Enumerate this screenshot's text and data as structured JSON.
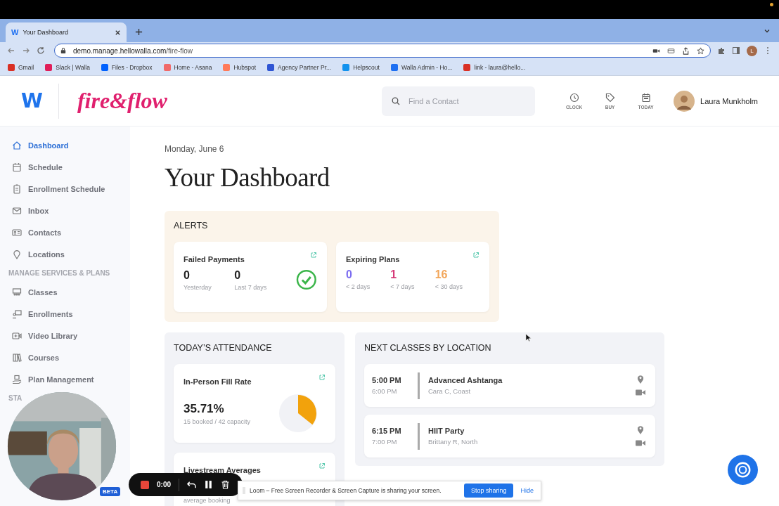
{
  "browser": {
    "tab": {
      "favicon": "W",
      "title": "Your Dashboard",
      "selected": true
    },
    "url": {
      "host": "demo.manage.hellowalla.com",
      "path": "/fire-flow"
    },
    "profile_initial": "L",
    "bookmarks": [
      {
        "label": "Gmail",
        "kind": "gmail"
      },
      {
        "label": "Slack | Walla",
        "kind": "slack"
      },
      {
        "label": "Files - Dropbox",
        "kind": "dropbox"
      },
      {
        "label": "Home - Asana",
        "kind": "asana"
      },
      {
        "label": "Hubspot",
        "kind": "hubspot"
      },
      {
        "label": "Agency Partner Pr...",
        "kind": "agency"
      },
      {
        "label": "Helpscout",
        "kind": "helpscout"
      },
      {
        "label": "Walla Admin - Ho...",
        "kind": "walla"
      },
      {
        "label": "link - laura@hello...",
        "kind": "gmail"
      }
    ]
  },
  "header": {
    "brand_mark": "W",
    "studio_logo": "fire&flow",
    "search": {
      "placeholder": "Find a Contact"
    },
    "actions": [
      {
        "label": "CLOCK",
        "kind": "clock"
      },
      {
        "label": "BUY",
        "kind": "tag"
      },
      {
        "label": "TODAY",
        "kind": "calendar"
      }
    ],
    "user": {
      "name": "Laura Munkholm"
    }
  },
  "sidebar": [
    {
      "kind": "item",
      "label": "Dashboard",
      "selected": true
    },
    {
      "kind": "item",
      "label": "Schedule",
      "selected": false
    },
    {
      "kind": "item",
      "label": "Enrollment Schedule",
      "selected": false
    },
    {
      "kind": "item",
      "label": "Inbox",
      "selected": false
    },
    {
      "kind": "item",
      "label": "Contacts",
      "selected": false
    },
    {
      "kind": "item",
      "label": "Locations",
      "selected": false
    },
    {
      "kind": "section",
      "label": "MANAGE SERVICES & PLANS"
    },
    {
      "kind": "item",
      "label": "Classes",
      "selected": false
    },
    {
      "kind": "item",
      "label": "Enrollments",
      "selected": false
    },
    {
      "kind": "item",
      "label": "Video Library",
      "selected": false
    },
    {
      "kind": "item",
      "label": "Courses",
      "selected": false
    },
    {
      "kind": "item",
      "label": "Plan Management",
      "selected": false
    },
    {
      "kind": "section",
      "label": "STA"
    }
  ],
  "page": {
    "date": "Monday, June 6",
    "title": "Your Dashboard"
  },
  "alerts": {
    "title": "ALERTS",
    "cards": [
      {
        "title": "Failed Payments",
        "all_clear": true,
        "stats": [
          {
            "value": "0",
            "caption": "Yesterday",
            "color": "#222222"
          },
          {
            "value": "0",
            "caption": "Last 7 days",
            "color": "#222222"
          }
        ]
      },
      {
        "title": "Expiring Plans",
        "all_clear": false,
        "stats": [
          {
            "value": "0",
            "caption": "< 2 days",
            "color": "#7b6cf0"
          },
          {
            "value": "1",
            "caption": "< 7 days",
            "color": "#d63a78"
          },
          {
            "value": "16",
            "caption": "< 30 days",
            "color": "#f2a65a"
          }
        ]
      }
    ]
  },
  "attendance": {
    "title": "TODAY’S ATTENDANCE",
    "cards": [
      {
        "kind": "fill_rate",
        "title": "In-Person Fill Rate",
        "value": "35.71%",
        "caption": "15 booked / 42 capacity"
      },
      {
        "kind": "livestream",
        "title": "Livestream Averages",
        "caption": "average booking"
      }
    ]
  },
  "next_classes": {
    "title": "NEXT CLASSES BY LOCATION",
    "items": [
      {
        "start": "5:00 PM",
        "end": "6:00 PM",
        "name": "Advanced Ashtanga",
        "detail": "Cara C, Coast"
      },
      {
        "start": "6:15 PM",
        "end": "7:00 PM",
        "name": "HIIT Party",
        "detail": "Brittany R, North"
      }
    ]
  },
  "recorder": {
    "time": "0:00",
    "badge": "BETA"
  },
  "share_banner": {
    "message": "Loom – Free Screen Recorder & Screen Capture is sharing your screen.",
    "stop": "Stop sharing",
    "hide": "Hide"
  }
}
